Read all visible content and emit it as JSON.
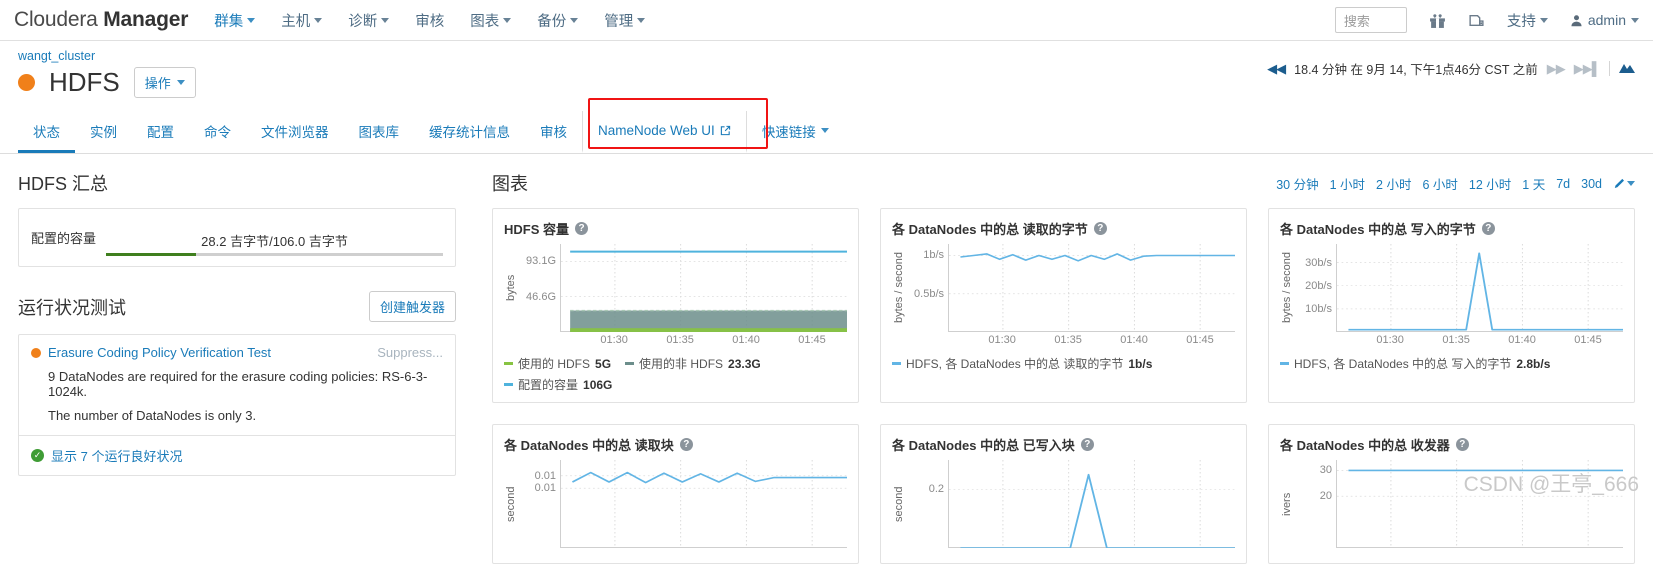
{
  "navbar": {
    "brand_light": "Cloudera ",
    "brand_bold": "Manager",
    "items": [
      {
        "label": "群集",
        "active": true,
        "caret": true
      },
      {
        "label": "主机",
        "active": false,
        "caret": true
      },
      {
        "label": "诊断",
        "active": false,
        "caret": true
      },
      {
        "label": "审核",
        "active": false,
        "caret": false
      },
      {
        "label": "图表",
        "active": false,
        "caret": true
      },
      {
        "label": "备份",
        "active": false,
        "caret": true
      },
      {
        "label": "管理",
        "active": false,
        "caret": true
      }
    ],
    "search_placeholder": "搜索",
    "search_value": "",
    "gift_icon": "gift-icon",
    "parcel_icon": "parcel-icon",
    "support_label": "支持",
    "user_label": "admin"
  },
  "header": {
    "breadcrumb": "wangt_cluster",
    "service_name": "HDFS",
    "status_color": "#f0801a",
    "actions_label": "操作",
    "time": {
      "back_icon": "rewind-icon",
      "text": "18.4 分钟 在 9月 14, 下午1点46分 CST 之前",
      "forward_icon": "fast-forward-icon",
      "end_icon": "skip-to-end-icon",
      "chart_icon": "chart-icon"
    }
  },
  "tabs": [
    {
      "label": "状态",
      "active": true,
      "external": false,
      "highlight": false
    },
    {
      "label": "实例",
      "active": false,
      "external": false,
      "highlight": false
    },
    {
      "label": "配置",
      "active": false,
      "external": false,
      "highlight": false
    },
    {
      "label": "命令",
      "active": false,
      "external": false,
      "highlight": false
    },
    {
      "label": "文件浏览器",
      "active": false,
      "external": false,
      "highlight": false
    },
    {
      "label": "图表库",
      "active": false,
      "external": false,
      "highlight": false
    },
    {
      "label": "缓存统计信息",
      "active": false,
      "external": false,
      "highlight": false
    },
    {
      "label": "审核",
      "active": false,
      "external": false,
      "highlight": false
    },
    {
      "label": "NameNode Web UI",
      "active": false,
      "external": true,
      "highlight": true
    },
    {
      "label": "快速链接",
      "active": false,
      "external": false,
      "caret": true,
      "highlight": false
    }
  ],
  "summary": {
    "title": "HDFS 汇总",
    "capacity": {
      "label": "配置的容量",
      "text": "28.2 吉字节/106.0 吉字节",
      "percent": 26.6,
      "fill_color": "#3f7f1e"
    }
  },
  "health": {
    "title": "运行状况测试",
    "create_trigger_label": "创建触发器",
    "item": {
      "name": "Erasure Coding Policy Verification Test",
      "suppress_label": "Suppress...",
      "status_color": "#f0801a",
      "message_line1": "9 DataNodes are required for the erasure coding policies: RS-6-3-1024k.",
      "message_line2": "The number of DataNodes is only 3."
    },
    "good_label": "显示 7 个运行良好状况"
  },
  "charts_section": {
    "title": "图表",
    "ranges": [
      "30 分钟",
      "1 小时",
      "2 小时",
      "6 小时",
      "12 小时",
      "1 天",
      "7d",
      "30d"
    ],
    "edit_icon": "pencil-icon"
  },
  "chart_data": [
    {
      "type": "area",
      "title": "HDFS 容量",
      "ylabel": "bytes",
      "yticks": [
        "93.1G",
        "46.6G"
      ],
      "ylim": [
        0,
        116
      ],
      "xticks": [
        "01:30",
        "01:35",
        "01:40",
        "01:45"
      ],
      "grid": true,
      "series": [
        {
          "name": "使用的 HDFS",
          "value": "5G",
          "color": "#87c342",
          "level": 5
        },
        {
          "name": "使用的非 HDFS",
          "value": "23.3G",
          "color": "#6c8e8b",
          "level": 28.3
        },
        {
          "name": "配置的容量",
          "value": "106G",
          "color": "#4fb3dd",
          "level": 106
        }
      ],
      "legend_position": "bottom"
    },
    {
      "type": "line",
      "title": "各 DataNodes 中的总 读取的字节",
      "ylabel": "bytes / second",
      "yticks": [
        "1b/s",
        "0.5b/s"
      ],
      "ylim": [
        0,
        1.15
      ],
      "xticks": [
        "01:30",
        "01:35",
        "01:40",
        "01:45"
      ],
      "grid": true,
      "series": [
        {
          "name": "HDFS, 各 DataNodes 中的总 读取的字节",
          "value": "1b/s",
          "color": "#62b5e5",
          "values": [
            0.98,
            1.0,
            1.02,
            0.95,
            1.01,
            0.94,
            1.0,
            0.95,
            1.0,
            0.93,
            1.0,
            0.95,
            1.02,
            0.94,
            0.99,
            1.0,
            1.0,
            1.0,
            1.0,
            1.0,
            1.0,
            1.0
          ]
        }
      ],
      "legend_position": "bottom"
    },
    {
      "type": "line",
      "title": "各 DataNodes 中的总 写入的字节",
      "ylabel": "bytes / second",
      "yticks": [
        "30b/s",
        "20b/s",
        "10b/s"
      ],
      "ylim": [
        0,
        38
      ],
      "xticks": [
        "01:30",
        "01:35",
        "01:40",
        "01:45"
      ],
      "grid": true,
      "series": [
        {
          "name": "HDFS, 各 DataNodes 中的总 写入的字节",
          "value": "2.8b/s",
          "color": "#62b5e5",
          "values": [
            1,
            1,
            1,
            1,
            1,
            1,
            1,
            1,
            1,
            1,
            34,
            1,
            1,
            1,
            1,
            1,
            1,
            1,
            1,
            1,
            1,
            1
          ]
        }
      ],
      "legend_position": "bottom"
    },
    {
      "type": "line",
      "title": "各 DataNodes 中的总 读取块",
      "ylabel": "second",
      "yticks": [
        "0.01",
        "0.01"
      ],
      "ylim": [
        0,
        0.014
      ],
      "xticks": [],
      "grid": true,
      "series": [
        {
          "name": "读取块",
          "value": "",
          "color": "#62b5e5",
          "values": [
            0.0105,
            0.012,
            0.0105,
            0.012,
            0.0104,
            0.0119,
            0.0105,
            0.0118,
            0.0105,
            0.0119,
            0.0106,
            0.0112,
            0.0112,
            0.0112,
            0.0112,
            0.0112
          ]
        }
      ],
      "legend_position": "bottom"
    },
    {
      "type": "line",
      "title": "各 DataNodes 中的总 已写入块",
      "ylabel": "second",
      "yticks": [
        "0.2"
      ],
      "ylim": [
        0,
        0.3
      ],
      "xticks": [],
      "grid": true,
      "series": [
        {
          "name": "已写入块",
          "value": "",
          "color": "#62b5e5",
          "values": [
            0,
            0,
            0,
            0,
            0,
            0,
            0,
            0.25,
            0,
            0,
            0,
            0,
            0,
            0,
            0,
            0
          ]
        }
      ],
      "legend_position": "bottom"
    },
    {
      "type": "line",
      "title": "各 DataNodes 中的总 收发器",
      "ylabel": "ivers",
      "yticks": [
        "30",
        "20"
      ],
      "ylim": [
        0,
        34
      ],
      "xticks": [],
      "grid": true,
      "series": [
        {
          "name": "收发器",
          "value": "",
          "color": "#62b5e5",
          "values": [
            30,
            30,
            30,
            30,
            30,
            30,
            30,
            30,
            30,
            30,
            30,
            30,
            30,
            30,
            30,
            30
          ]
        }
      ],
      "legend_position": "bottom"
    }
  ],
  "watermark": "CSDN @王亭_666"
}
